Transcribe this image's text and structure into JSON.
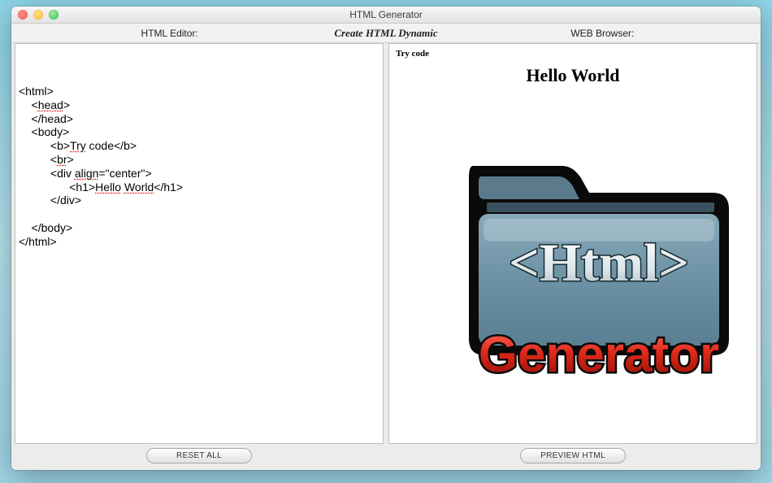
{
  "window": {
    "title": "HTML Generator"
  },
  "header": {
    "left_label": "HTML Editor:",
    "center_label": "Create HTML Dynamic",
    "right_label": "WEB Browser:"
  },
  "editor": {
    "line1": "<html>",
    "line2_indent": "    <",
    "line2_word": "head",
    "line2_end": ">",
    "line3": "    </head>",
    "line4": "    <body>",
    "line5_indent": "          <b>",
    "line5_word": "Try",
    "line5_end": " code</b>",
    "line6_indent": "          <",
    "line6_word": "br",
    "line6_end": ">",
    "line7": "          <div ",
    "line7_word": "align",
    "line7_end": "=\"center\">",
    "line8_indent": "                <h1>",
    "line8_word": "Hello",
    "line8_mid": " ",
    "line8_word2": "World",
    "line8_end": "</h1>",
    "line9": "          </div>",
    "blank": "",
    "line10": "    </body>",
    "line11": "</html>"
  },
  "preview": {
    "bold_text": "Try code",
    "heading": "Hello World",
    "image_top": "<Html>",
    "image_bottom": "Generator"
  },
  "buttons": {
    "reset": "RESET ALL",
    "preview": "PREVIEW HTML"
  },
  "icons": {
    "close": "close",
    "minimize": "minimize",
    "zoom": "zoom"
  }
}
